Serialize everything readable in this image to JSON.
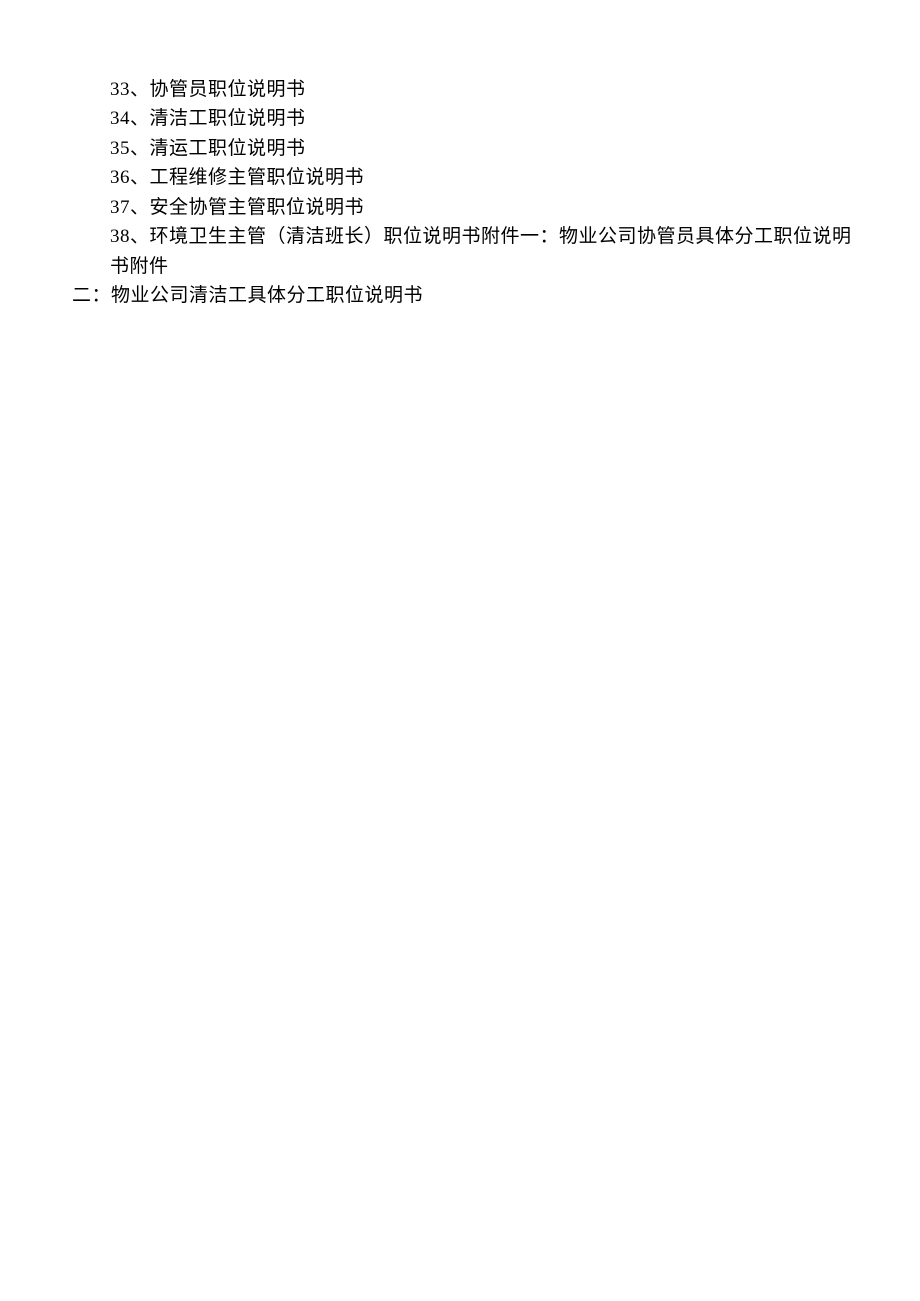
{
  "items": [
    {
      "num": "33",
      "text": "、协管员职位说明书"
    },
    {
      "num": "34",
      "text": "、清洁工职位说明书"
    },
    {
      "num": "35",
      "text": "、清运工职位说明书"
    },
    {
      "num": "36",
      "text": "、工程维修主管职位说明书"
    },
    {
      "num": "37",
      "text": "、安全协管主管职位说明书"
    }
  ],
  "item38": {
    "num": "38",
    "line1": "、环境卫生主管（清洁班长）职位说明书附件一：物业公司协管员具体分工职位说明书附件",
    "line2": "二：物业公司清洁工具体分工职位说明书"
  }
}
